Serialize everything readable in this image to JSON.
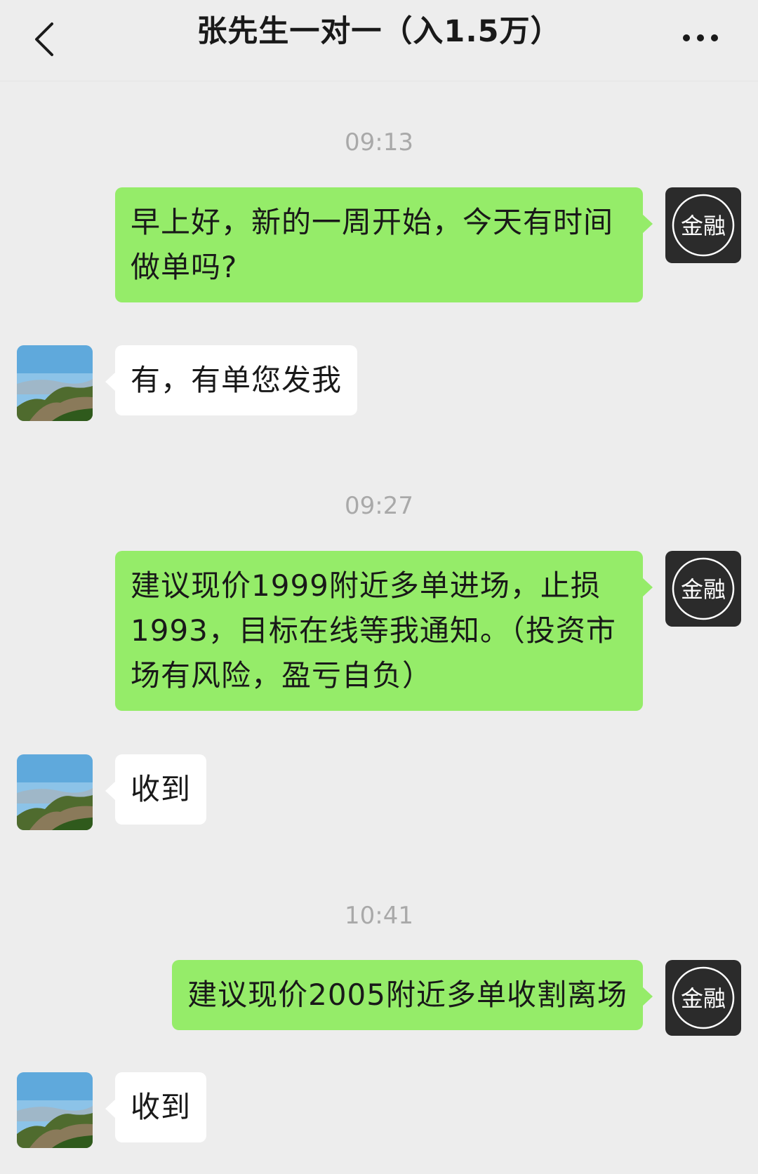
{
  "header": {
    "title": "张先生一对一（入1.5万）"
  },
  "avatars": {
    "self_logo_text": "金融"
  },
  "messages": [
    {
      "time": "09:13"
    },
    {
      "text": "早上好，新的一周开始，今天有时间做单吗?"
    },
    {
      "text": "有，有单您发我"
    },
    {
      "time": "09:27"
    },
    {
      "text": "建议现价1999附近多单进场，止损1993，目标在线等我通知。（投资市场有风险，盈亏自负）"
    },
    {
      "text": "收到"
    },
    {
      "time": "10:41"
    },
    {
      "text": "建议现价2005附近多单收割离场"
    },
    {
      "text": "收到"
    }
  ]
}
